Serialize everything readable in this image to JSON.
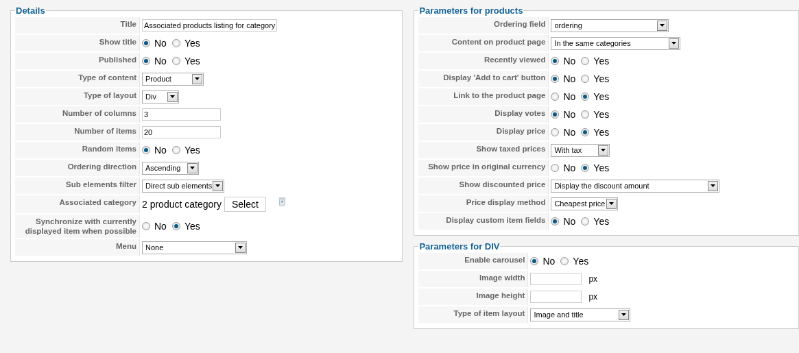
{
  "panels": [
    {
      "legend": "Details",
      "rows": [
        {
          "label": "Title",
          "kind": "text",
          "value": "Associated products listing for category"
        },
        {
          "label": "Show title",
          "kind": "radio",
          "options": [
            {
              "label": "No",
              "selected": true
            },
            {
              "label": "Yes",
              "selected": false
            }
          ]
        },
        {
          "label": "Published",
          "kind": "radio",
          "options": [
            {
              "label": "No",
              "selected": true
            },
            {
              "label": "Yes",
              "selected": false
            }
          ]
        },
        {
          "label": "Type of content",
          "kind": "select",
          "value": "Product"
        },
        {
          "label": "Type of layout",
          "kind": "select",
          "value": "Div"
        },
        {
          "label": "Number of columns",
          "kind": "text",
          "value": "3"
        },
        {
          "label": "Number of items",
          "kind": "text",
          "value": "20"
        },
        {
          "label": "Random items",
          "kind": "radio",
          "options": [
            {
              "label": "No",
              "selected": true
            },
            {
              "label": "Yes",
              "selected": false
            }
          ]
        },
        {
          "label": "Ordering direction",
          "kind": "select",
          "value": "Ascending"
        },
        {
          "label": "Sub elements filter",
          "kind": "select",
          "value": "Direct sub elements"
        },
        {
          "label": "Associated category",
          "kind": "category",
          "value": "2 product category",
          "button": "Select"
        },
        {
          "label": "Synchronize with currently displayed item when possible",
          "kind": "radio",
          "options": [
            {
              "label": "No",
              "selected": false
            },
            {
              "label": "Yes",
              "selected": true
            }
          ]
        },
        {
          "label": "Menu",
          "kind": "select",
          "value": "None"
        }
      ]
    },
    {
      "legend": "Parameters for products",
      "rows": [
        {
          "label": "Ordering field",
          "kind": "select",
          "value": "ordering"
        },
        {
          "label": "Content on product page",
          "kind": "select",
          "value": "In the same categories"
        },
        {
          "label": "Recently viewed",
          "kind": "radio",
          "options": [
            {
              "label": "No",
              "selected": true
            },
            {
              "label": "Yes",
              "selected": false
            }
          ]
        },
        {
          "label": "Display 'Add to cart' button",
          "kind": "radio",
          "options": [
            {
              "label": "No",
              "selected": true
            },
            {
              "label": "Yes",
              "selected": false
            }
          ]
        },
        {
          "label": "Link to the product page",
          "kind": "radio",
          "options": [
            {
              "label": "No",
              "selected": false
            },
            {
              "label": "Yes",
              "selected": true
            }
          ]
        },
        {
          "label": "Display votes",
          "kind": "radio",
          "options": [
            {
              "label": "No",
              "selected": true
            },
            {
              "label": "Yes",
              "selected": false
            }
          ]
        },
        {
          "label": "Display price",
          "kind": "radio",
          "options": [
            {
              "label": "No",
              "selected": false
            },
            {
              "label": "Yes",
              "selected": true
            }
          ]
        },
        {
          "label": "Show taxed prices",
          "kind": "select",
          "value": "With tax"
        },
        {
          "label": "Show price in original currency",
          "kind": "radio",
          "options": [
            {
              "label": "No",
              "selected": false
            },
            {
              "label": "Yes",
              "selected": true
            }
          ]
        },
        {
          "label": "Show discounted price",
          "kind": "select",
          "value": "Display the discount amount"
        },
        {
          "label": "Price display method",
          "kind": "select",
          "value": "Cheapest price"
        },
        {
          "label": "Display custom item fields",
          "kind": "radio",
          "options": [
            {
              "label": "No",
              "selected": true
            },
            {
              "label": "Yes",
              "selected": false
            }
          ]
        }
      ]
    },
    {
      "legend": "Parameters for DIV",
      "rows": [
        {
          "label": "Enable carousel",
          "kind": "radio",
          "options": [
            {
              "label": "No",
              "selected": true
            },
            {
              "label": "Yes",
              "selected": false
            }
          ]
        },
        {
          "label": "Image width",
          "kind": "unit",
          "unit": "px"
        },
        {
          "label": "Image height",
          "kind": "unit",
          "unit": "px"
        },
        {
          "label": "Type of item layout",
          "kind": "select",
          "value": "Image and title"
        }
      ]
    }
  ]
}
